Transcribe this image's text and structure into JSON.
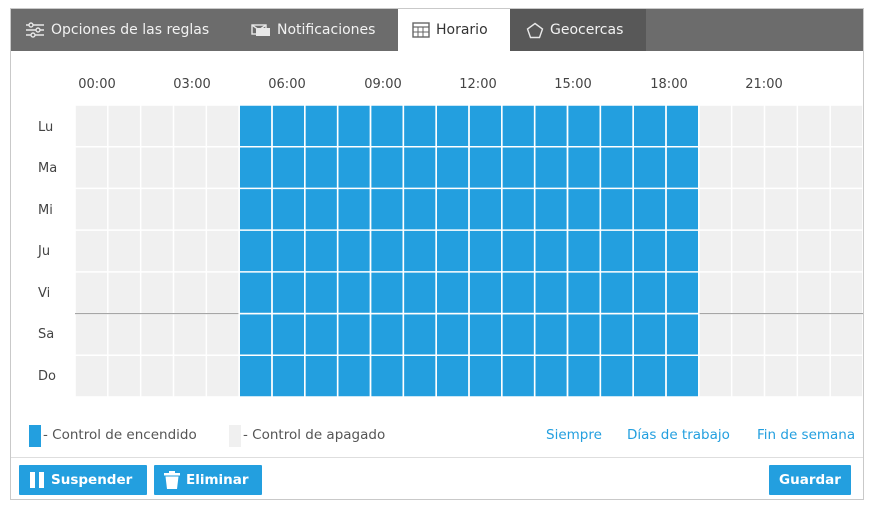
{
  "tabs": [
    {
      "label": "Opciones de las reglas",
      "icon": "sliders-icon"
    },
    {
      "label": "Notificaciones",
      "icon": "notifications-icon"
    },
    {
      "label": "Horario",
      "icon": "schedule-icon",
      "active": true
    },
    {
      "label": "Geocercas",
      "icon": "pentagon-icon"
    }
  ],
  "schedule": {
    "hours": [
      "00:00",
      "03:00",
      "06:00",
      "09:00",
      "12:00",
      "15:00",
      "18:00",
      "21:00"
    ],
    "days": [
      "Lu",
      "Ma",
      "Mi",
      "Ju",
      "Vi",
      "Sa",
      "Do"
    ],
    "slots_per_day": 24,
    "active_from_hour": 5,
    "active_to_hour": 19,
    "on_color": "#239fdf",
    "off_color": "#f0f0f0"
  },
  "legend": {
    "on": "- Control de encendido",
    "off": "- Control de apagado"
  },
  "quick_links": [
    "Siempre",
    "Días de trabajo",
    "Fin de semana"
  ],
  "buttons": {
    "suspend": "Suspender",
    "delete": "Eliminar",
    "save": "Guardar"
  }
}
